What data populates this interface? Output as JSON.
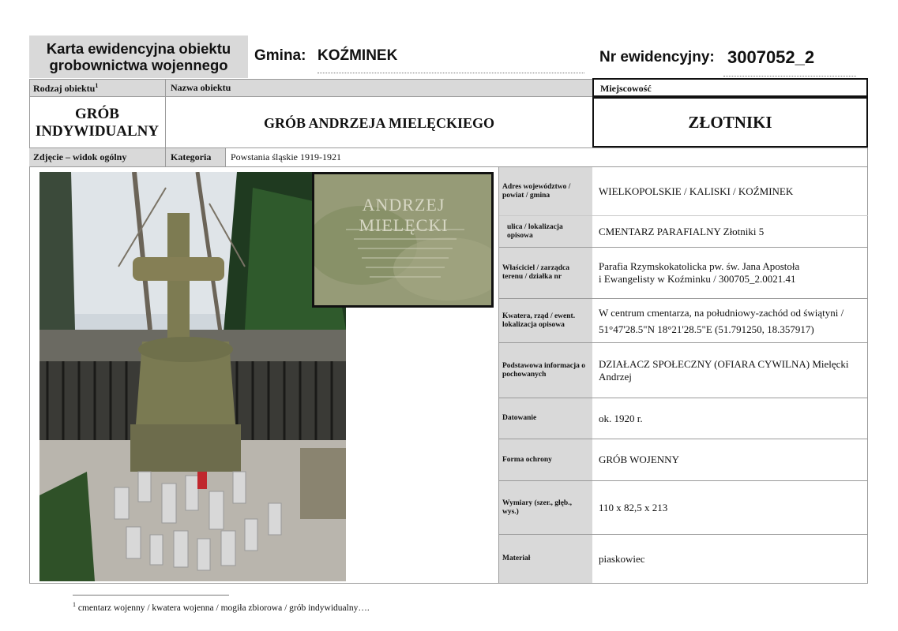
{
  "header": {
    "title_line1": "Karta ewidencyjna obiektu",
    "title_line2": "grobownictwa wojennego",
    "gmina_label": "Gmina:",
    "gmina_value": "KOŹMINEK",
    "nr_label": "Nr ewidencyjny:",
    "nr_value": "3007052_2"
  },
  "labels": {
    "rodzaj": "Rodzaj obiektu",
    "rodzaj_sup": "1",
    "nazwa": "Nazwa obiektu",
    "miejscowosc": "Miejscowość",
    "zdjecie": "Zdjęcie – widok ogólny",
    "kategoria": "Kategoria"
  },
  "values": {
    "rodzaj_line1": "GRÓB",
    "rodzaj_line2": "INDYWIDUALNY",
    "nazwa": "GRÓB ANDRZEJA MIELĘCKIEGO",
    "miejscowosc": "ZŁOTNIKI",
    "kategoria": "Powstania śląskie 1919-1921"
  },
  "photo": {
    "inset_text": "ANDRZEJ MIELĘCKI"
  },
  "rows": [
    {
      "label": "Adres województwo / powiat / gmina",
      "value": "WIELKOPOLSKIE / KALISKI / KOŹMINEK"
    },
    {
      "label": "ulica / lokalizacja opisowa",
      "value": "CMENTARZ PARAFIALNY Złotniki 5"
    },
    {
      "label": "Właściciel / zarządca terenu / działka nr",
      "value_line1": "Parafia Rzymskokatolicka pw. św. Jana Apostoła",
      "value_line2": "i Ewangelisty w Koźminku / 300705_2.0021.41"
    },
    {
      "label": "Kwatera, rząd / ewent. lokalizacja opisowa",
      "value_line1": "W centrum cmentarza, na południowy-zachód od świątyni /",
      "value_line2": "51°47'28.5\"N 18°21'28.5\"E (51.791250, 18.357917)"
    },
    {
      "label": "Podstawowa informacja o pochowanych",
      "value": "DZIAŁACZ SPOŁECZNY (OFIARA CYWILNA) Mielęcki Andrzej"
    },
    {
      "label": "Datowanie",
      "value": "ok. 1920 r."
    },
    {
      "label": "Forma ochrony",
      "value": "GRÓB WOJENNY"
    },
    {
      "label": "Wymiary (szer., głęb., wys.)",
      "value": "110 x 82,5 x 213"
    },
    {
      "label": "Materiał",
      "value": "piaskowiec"
    }
  ],
  "footnote": {
    "sup": "1",
    "text": "cmentarz wojenny / kwatera wojenna / mogiła zbiorowa / grób indywidualny…."
  }
}
